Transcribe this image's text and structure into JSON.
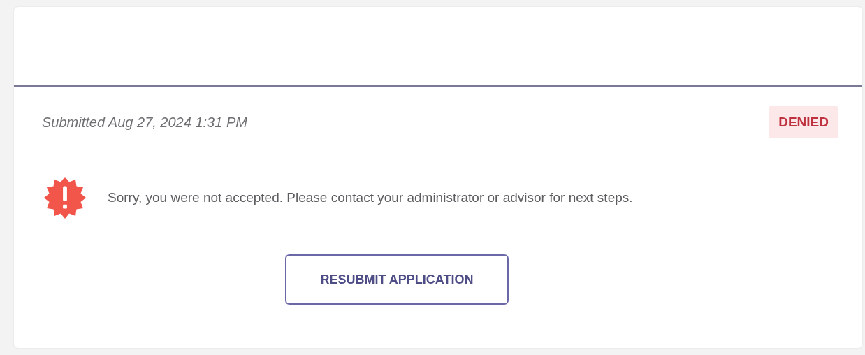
{
  "application": {
    "submitted": "Submitted Aug 27, 2024 1:31 PM",
    "status": {
      "label": "DENIED",
      "kind": "denied"
    },
    "message": {
      "kind": "error",
      "text": "Sorry, you were not accepted. Please contact your administrator or advisor for next steps."
    },
    "action": "RESUBMIT APPLICATION"
  }
}
